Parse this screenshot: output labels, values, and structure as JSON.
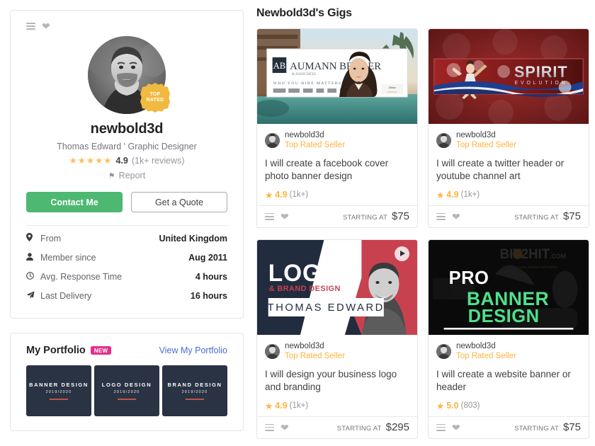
{
  "profile": {
    "icons": {
      "menu": "hamburger-menu-icon",
      "favorite": "heart-icon"
    },
    "badge": {
      "line1": "TOP",
      "line2": "RATED"
    },
    "username": "newbold3d",
    "tagline": "Thomas Edward ' Graphic Designer",
    "stars": "★★★★★",
    "rating": "4.9",
    "reviews": "(1k+ reviews)",
    "report_label": "Report",
    "contact_button": "Contact Me",
    "quote_button": "Get a Quote",
    "stats": [
      {
        "icon": "location-pin-icon",
        "glyph": "✉",
        "label": "From",
        "value": "United Kingdom"
      },
      {
        "icon": "user-icon",
        "glyph": "♟",
        "label": "Member since",
        "value": "Aug 2011"
      },
      {
        "icon": "clock-icon",
        "glyph": "◴",
        "label": "Avg. Response Time",
        "value": "4 hours"
      },
      {
        "icon": "send-icon",
        "glyph": "➤",
        "label": "Last Delivery",
        "value": "16 hours"
      }
    ]
  },
  "portfolio": {
    "title": "My Portfolio",
    "new_badge": "NEW",
    "link": "View My Portfolio",
    "accent_color": "#e62e8b",
    "link_color": "#4a6bd6",
    "items": [
      {
        "title": "BANNER DESIGN",
        "years": "2019/2020"
      },
      {
        "title": "LOGO DESIGN",
        "years": "2019/2020"
      },
      {
        "title": "BRAND DESIGN",
        "years": "2019/2020"
      }
    ]
  },
  "gigs_section": {
    "heading": "Newbold3d's Gigs",
    "starting_label": "STARTING AT",
    "seller_name": "newbold3d",
    "seller_level": "Top Rated Seller",
    "gigs": [
      {
        "thumb": "facebook-cover-banner-thumbnail",
        "title": "I will create a facebook cover photo banner design",
        "rating": "4.9",
        "reviews": "(1k+)",
        "price": "$75",
        "has_video": false
      },
      {
        "thumb": "spirit-evolution-twitter-header-thumbnail",
        "title": "I will create a twitter header or youtube channel art",
        "rating": "4.9",
        "reviews": "(1k+)",
        "price": "$75",
        "has_video": false
      },
      {
        "thumb": "logo-brand-design-thumbnail",
        "title": "I will design your business logo and branding",
        "rating": "4.9",
        "reviews": "(1k+)",
        "price": "$295",
        "has_video": true
      },
      {
        "thumb": "pro-banner-design-thumbnail",
        "title": "I will create a website banner or header",
        "rating": "5.0",
        "reviews": "(803)",
        "price": "$75",
        "has_video": false
      }
    ]
  },
  "thumb_art": {
    "gig1": {
      "brand": "AUMANN BENDER",
      "sub": "& ASSOCIATES",
      "tagline": "WHO YOU HIRE MATTERS!",
      "mono": "AB"
    },
    "gig2": {
      "brand": "SPIRIT",
      "sub": "EVOLUTION"
    },
    "gig3": {
      "line1": "LOGO",
      "line2": "& BRAND DESIGN",
      "name": "THOMAS EDWARD"
    },
    "gig4": {
      "line1": "PRO",
      "line2": "BANNER",
      "line3": "DESIGN",
      "watermark": "BIT2HIT.COM"
    }
  },
  "colors": {
    "green": "#4db872",
    "gold": "#f0b93f",
    "star": "#ffb33e",
    "navy": "#2a3343"
  }
}
